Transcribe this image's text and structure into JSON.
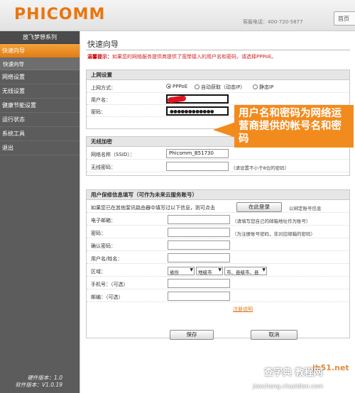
{
  "header": {
    "logo": "PHICOMM",
    "hotline": "客服电话：400-720-5877",
    "top_button": "首页"
  },
  "sidebar": {
    "title": "放飞梦想系列",
    "items": [
      {
        "label": "快速向导",
        "active": true
      },
      {
        "label": "快速向导",
        "sub": true
      },
      {
        "label": "网络设置"
      },
      {
        "label": "无线设置"
      },
      {
        "label": "健康节能设置"
      },
      {
        "label": "运行状态"
      },
      {
        "label": "系统工具"
      },
      {
        "label": "退出"
      }
    ],
    "hw_version": "硬件版本：1.0",
    "sw_version": "软件版本：V1.0.19"
  },
  "main": {
    "title": "快速向导",
    "tip_label": "温馨提示：",
    "tip_text": "如果您的网络服务提供商提供了宽带接入的用户名和密码，请选择PPPoE。",
    "net": {
      "heading": "上网设置",
      "mode_label": "上网方式：",
      "modes": [
        "PPPoE",
        "自动获取（动态IP）",
        "静态IP"
      ],
      "username_label": "用户名：",
      "username_value": "",
      "password_label": "密码：",
      "password_value": "●●●●●●●●●●●●"
    },
    "wireless": {
      "heading": "无线加密",
      "ssid_label": "网络名称（SSID）：",
      "ssid_value": "Phicomm_B51730",
      "key_label": "无线密码：",
      "key_value": "",
      "key_hint": "（请设置不小于8位的密码）"
    },
    "account": {
      "heading": "用户保修信息填写（可作为未来云服务账号）",
      "login_text": "如果您已在其他斐讯路由器中填写过以下信息，则可点击",
      "login_button": "在此登录",
      "login_after": "以绑定账号信息",
      "email_label": "电子邮箱：",
      "email_hint": "（请填写您自己的邮箱地址作为账号）",
      "pwd_label": "密码：",
      "pwd_hint": "（为注册账号密码，非对应邮箱的密码）",
      "confirm_label": "确认密码：",
      "name_label": "用户名/姓名：",
      "region_label": "区域：",
      "province": "省份",
      "city": "地级市",
      "county": "市、县级市、县",
      "phone_label": "手机号：（可选）",
      "zip_label": "邮编：（可选）",
      "register_link": "注册说明"
    },
    "save_button": "保存",
    "cancel_button": "取消"
  },
  "annotation": "用户名和密码为网络运营商提供的帐号名和密码",
  "watermark": {
    "site": "查字典 教程网",
    "url": "jiaocheng.chazidian.com",
    "mark": "jb51.net"
  }
}
